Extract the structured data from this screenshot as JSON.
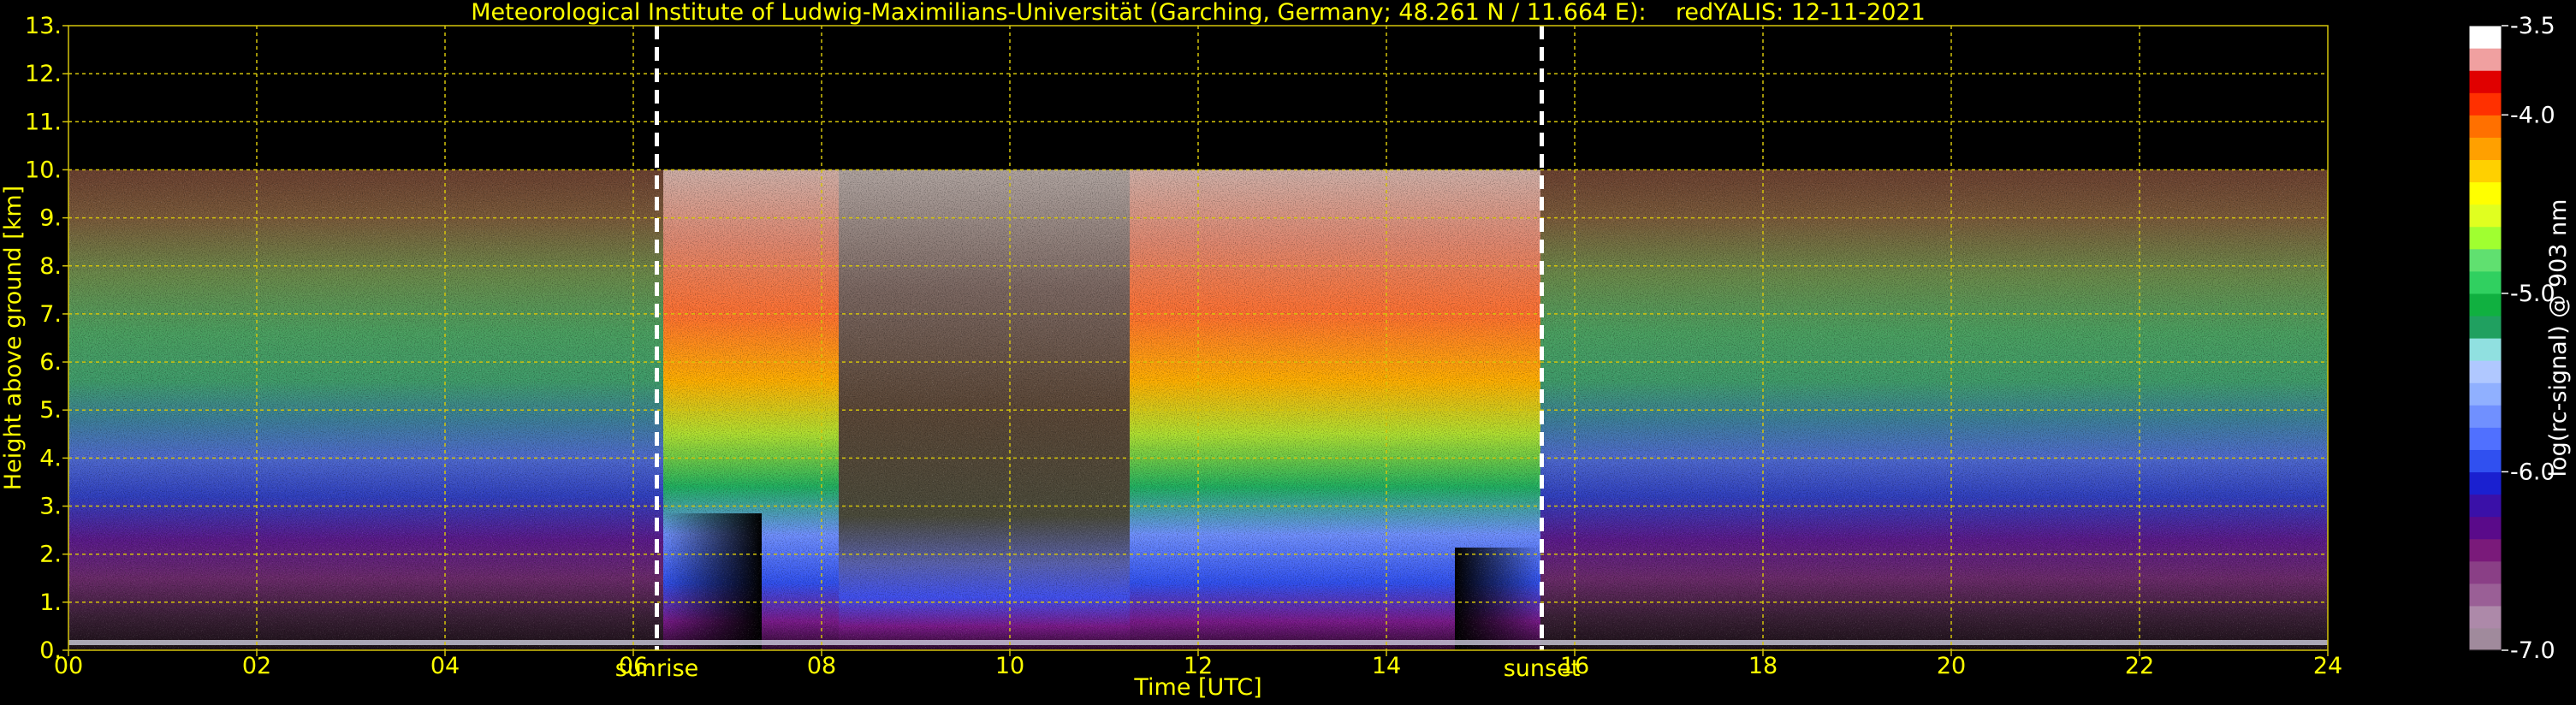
{
  "chart_data": {
    "type": "heatmap",
    "title": "Meteorological Institute of Ludwig-Maximilians-Universität (Garching, Germany; 48.261 N / 11.664 E):    redYALIS: 12-11-2021",
    "xlabel": "Time [UTC]",
    "ylabel": "Height above ground [km]",
    "xlim": [
      0,
      24
    ],
    "ylim": [
      0,
      13
    ],
    "x_ticks": [
      "00",
      "02",
      "04",
      "06",
      "08",
      "10",
      "12",
      "14",
      "16",
      "18",
      "20",
      "22",
      "24"
    ],
    "y_ticks": [
      "0.",
      "1.",
      "2.",
      "3.",
      "4.",
      "5.",
      "6.",
      "7.",
      "8.",
      "9.",
      "10.",
      "11.",
      "12.",
      "13."
    ],
    "grid": true,
    "data_top_km": 10,
    "annotations": [
      {
        "text": "sunrise",
        "x": 6.25
      },
      {
        "text": "sunset",
        "x": 15.65
      }
    ],
    "colorbar": {
      "label": "log(rc-signal) @ 903 nm",
      "range": [
        -7.0,
        -3.5
      ],
      "ticks": [
        "-3.5",
        "-4.0",
        "-5.0",
        "-6.0",
        "-7.0"
      ],
      "tick_values": [
        -3.5,
        -4.0,
        -5.0,
        -6.0,
        -7.0
      ],
      "colors": [
        "#a08a9c",
        "#ad89a9",
        "#9a5f96",
        "#8a3f86",
        "#7a1a7a",
        "#5a0a8a",
        "#3a10a8",
        "#1a20d0",
        "#3050f0",
        "#5070ff",
        "#7090ff",
        "#90b0ff",
        "#b0c8ff",
        "#90e0e0",
        "#20a060",
        "#10b040",
        "#30d060",
        "#60e070",
        "#a0ff30",
        "#e0ff20",
        "#ffff00",
        "#ffd000",
        "#ffa000",
        "#ff7000",
        "#ff3000",
        "#e00000",
        "#f0a0a0",
        "#ffffff"
      ]
    }
  },
  "colors": {
    "background": "#000000",
    "axis_text": "#ffff00",
    "grid": "#d4c40a",
    "sun_lines": "#ffffff",
    "colorbar_text": "#ffffff"
  }
}
